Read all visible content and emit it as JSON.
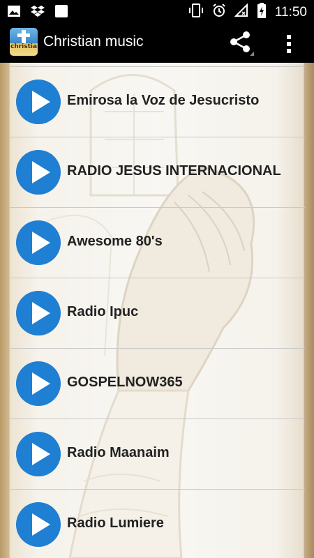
{
  "status_bar": {
    "time": "11:50",
    "left_icons": [
      "image-icon",
      "dropbox-icon",
      "blank-square-icon"
    ],
    "right_icons": [
      "vibrate-icon",
      "alarm-icon",
      "no-signal-icon",
      "battery-charging-icon"
    ]
  },
  "action_bar": {
    "app_logo_text": "christian",
    "title": "Christian music",
    "share_icon": "share-icon",
    "overflow_icon": "overflow-menu-icon"
  },
  "stations": [
    {
      "label": "Emirosa la Voz de Jesucristo"
    },
    {
      "label": "RADIO JESUS INTERNACIONAL"
    },
    {
      "label": "Awesome 80's"
    },
    {
      "label": "Radio Ipuc"
    },
    {
      "label": "GOSPELNOW365"
    },
    {
      "label": "Radio Maanaim"
    },
    {
      "label": "Radio Lumiere"
    }
  ],
  "colors": {
    "play_button": "#1e7fd3",
    "bar_background": "#000000"
  }
}
